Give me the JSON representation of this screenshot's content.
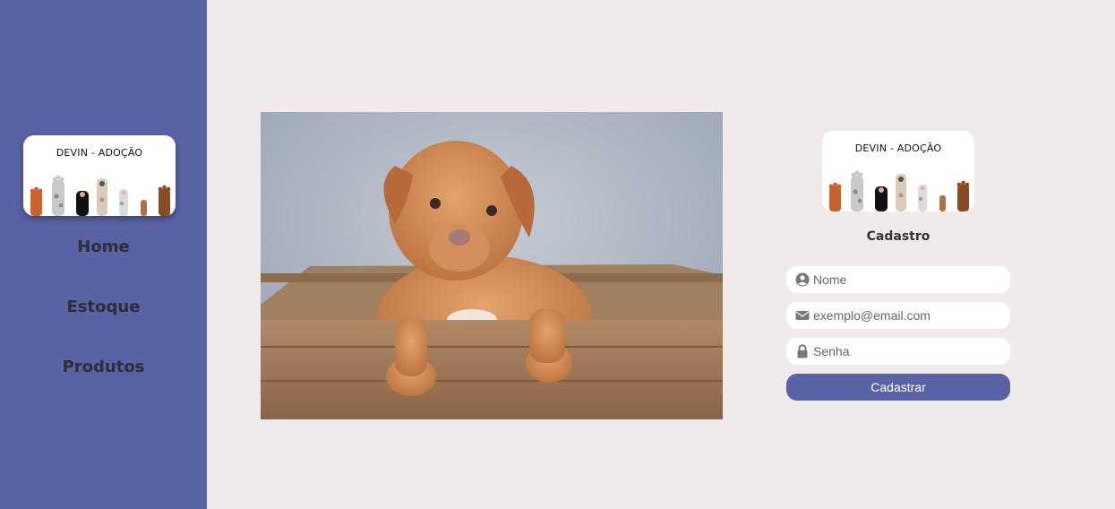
{
  "sidebar": {
    "logo_title": "DEVIN - ADOÇÃO",
    "nav": [
      {
        "label": "Home"
      },
      {
        "label": "Estoque"
      },
      {
        "label": "Produtos"
      }
    ]
  },
  "register": {
    "logo_title": "DEVIN - ADOÇÃO",
    "title": "Cadastro",
    "fields": [
      {
        "placeholder": "Nome",
        "icon": "user-circle-icon",
        "value": ""
      },
      {
        "placeholder": "exemplo@email.com",
        "icon": "envelope-icon",
        "value": ""
      },
      {
        "placeholder": "Senha",
        "icon": "lock-icon",
        "value": ""
      }
    ],
    "submit_label": "Cadastrar"
  },
  "colors": {
    "sidebar_bg": "#5a62a6",
    "page_bg": "#f0eaea",
    "button_bg": "#5a62a6"
  }
}
